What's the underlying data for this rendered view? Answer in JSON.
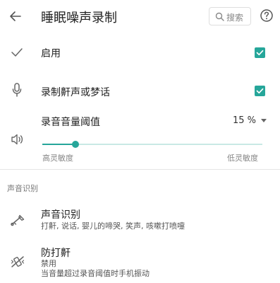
{
  "appbar": {
    "title": "睡眠噪声录制",
    "search_label": "搜索"
  },
  "settings": {
    "enable": {
      "label": "启用",
      "checked": true
    },
    "record_snoring": {
      "label": "录制鼾声或梦话",
      "checked": true
    },
    "threshold": {
      "label": "录音音量阈值",
      "value_text": "15 %",
      "value": 15,
      "low_label": "高灵敏度",
      "high_label": "低灵敏度"
    }
  },
  "sound_recognition": {
    "header": "声音识别",
    "item": {
      "title": "声音识别",
      "desc": "打鼾, 说话, 婴儿的啼哭, 笑声, 咳嗽打喷嚏"
    }
  },
  "anti_snoring": {
    "title": "防打鼾",
    "status": "禁用",
    "desc": "当音量超过录音阈值时手机振动"
  },
  "colors": {
    "accent": "#26a69a",
    "track": "#c9e9e5",
    "icon": "#666666"
  }
}
